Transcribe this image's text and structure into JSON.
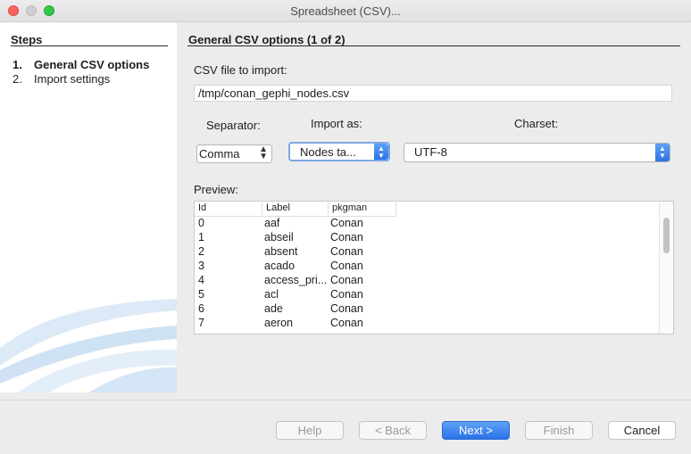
{
  "window": {
    "title": "Spreadsheet (CSV)..."
  },
  "steps": {
    "heading": "Steps",
    "items": [
      {
        "num": "1.",
        "label": "General CSV options",
        "active": true
      },
      {
        "num": "2.",
        "label": "Import settings",
        "active": false
      }
    ]
  },
  "main": {
    "heading": "General CSV options (1 of 2)",
    "file_label": "CSV file to import:",
    "file_value": "/tmp/conan_gephi_nodes.csv",
    "separator_label": "Separator:",
    "separator_value": "Comma",
    "import_as_label": "Import as:",
    "import_as_value": "Nodes ta...",
    "charset_label": "Charset:",
    "charset_value": "UTF-8",
    "preview_label": "Preview:"
  },
  "preview": {
    "columns": [
      "Id",
      "Label",
      "pkgman"
    ],
    "rows": [
      [
        "0",
        "aaf",
        "Conan"
      ],
      [
        "1",
        "abseil",
        "Conan"
      ],
      [
        "2",
        "absent",
        "Conan"
      ],
      [
        "3",
        "acado",
        "Conan"
      ],
      [
        "4",
        "access_pri...",
        "Conan"
      ],
      [
        "5",
        "acl",
        "Conan"
      ],
      [
        "6",
        "ade",
        "Conan"
      ],
      [
        "7",
        "aeron",
        "Conan"
      ]
    ]
  },
  "buttons": {
    "help": "Help",
    "back": "< Back",
    "next": "Next >",
    "finish": "Finish",
    "cancel": "Cancel"
  },
  "colors": {
    "accent": "#2a72e6",
    "traffic_close": "#fc605c",
    "traffic_max": "#34c84a"
  }
}
